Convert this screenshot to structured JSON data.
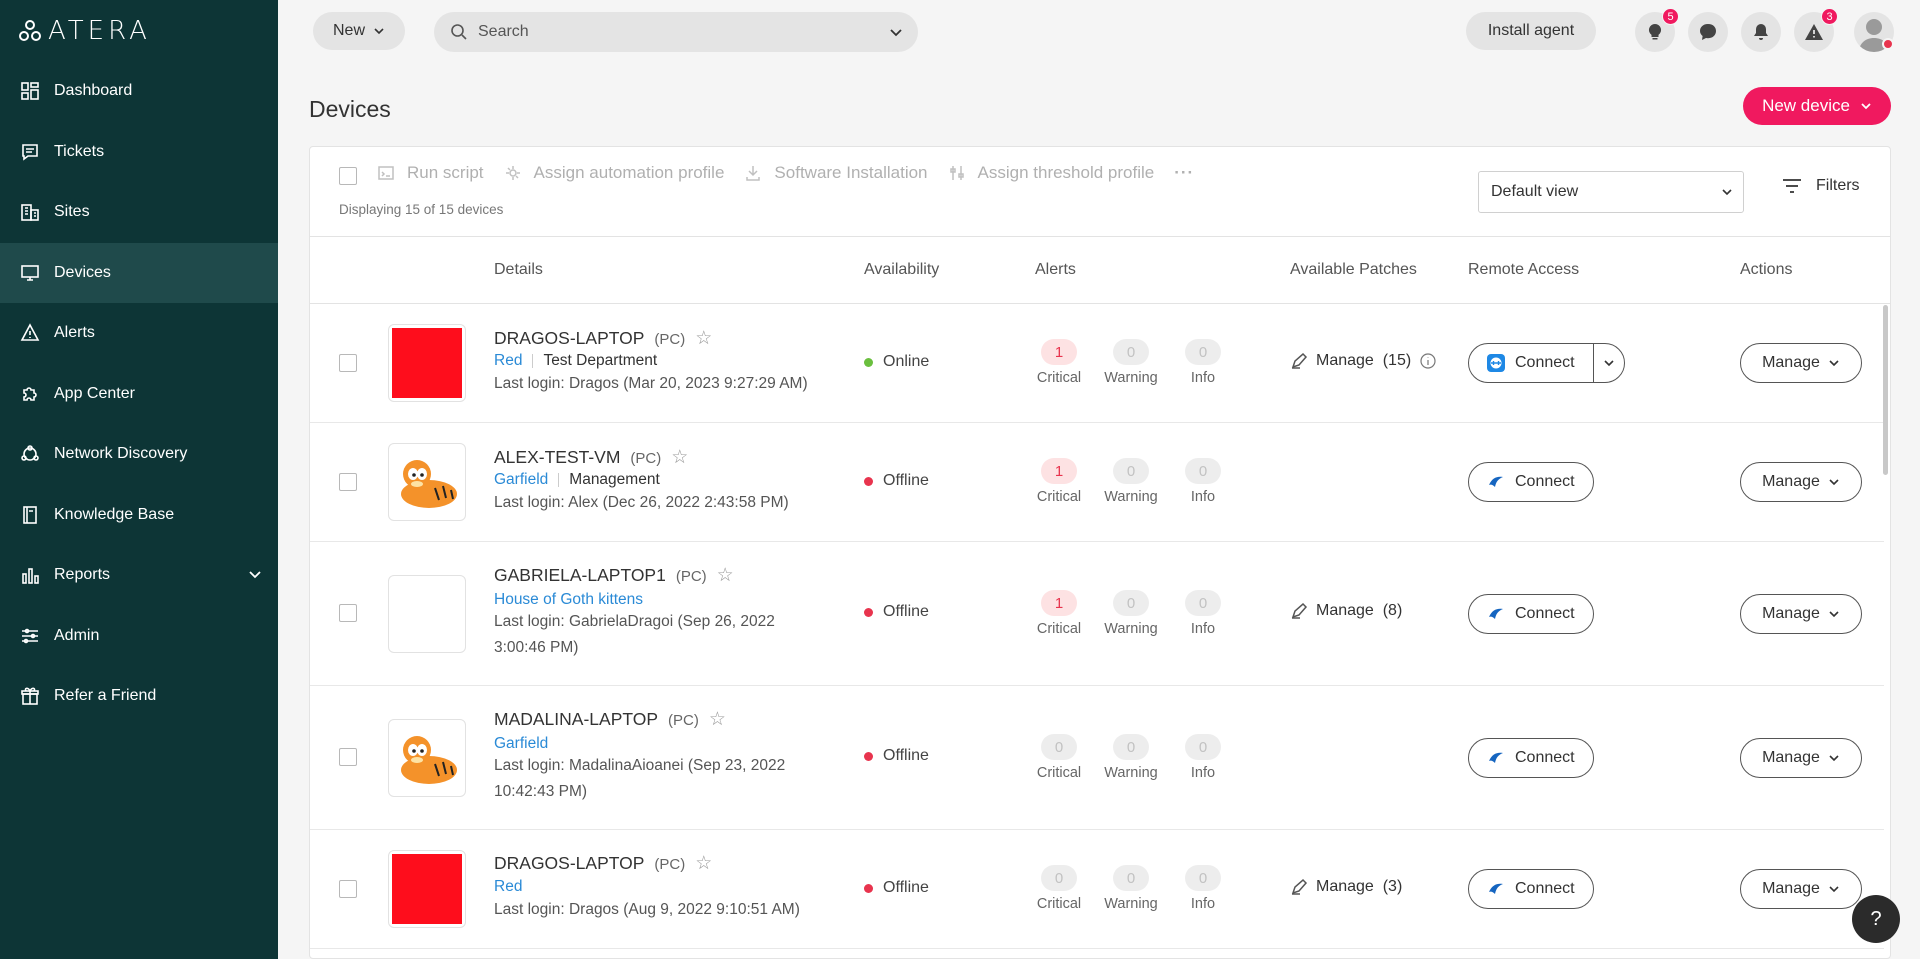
{
  "brand": {
    "name": "ATERA"
  },
  "sidebar": {
    "items": [
      {
        "label": "Dashboard",
        "icon": "dashboard-icon"
      },
      {
        "label": "Tickets",
        "icon": "ticket-icon"
      },
      {
        "label": "Sites",
        "icon": "building-icon"
      },
      {
        "label": "Devices",
        "icon": "monitor-icon",
        "active": true
      },
      {
        "label": "Alerts",
        "icon": "warning-icon"
      },
      {
        "label": "App Center",
        "icon": "puzzle-icon"
      },
      {
        "label": "Network Discovery",
        "icon": "network-icon"
      },
      {
        "label": "Knowledge Base",
        "icon": "book-icon"
      },
      {
        "label": "Reports",
        "icon": "chart-icon"
      },
      {
        "label": "Admin",
        "icon": "sliders-icon"
      },
      {
        "label": "Refer a Friend",
        "icon": "gift-icon"
      }
    ]
  },
  "topbar": {
    "new_label": "New",
    "search_placeholder": "Search",
    "install_agent_label": "Install agent",
    "notifications": {
      "tips_count": "5",
      "alerts_count": "3"
    }
  },
  "page": {
    "title": "Devices",
    "new_device_label": "New device"
  },
  "toolbar": {
    "run_script": "Run script",
    "assign_automation": "Assign automation profile",
    "software_installation": "Software Installation",
    "assign_threshold": "Assign threshold profile",
    "more": "···",
    "displaying": "Displaying 15 of 15 devices",
    "view": "Default view",
    "filters": "Filters"
  },
  "columns": {
    "details": "Details",
    "availability": "Availability",
    "alerts": "Alerts",
    "patches": "Available Patches",
    "remote": "Remote Access",
    "actions": "Actions"
  },
  "alert_labels": {
    "critical": "Critical",
    "warning": "Warning",
    "info": "Info"
  },
  "devices": [
    {
      "name": "DRAGOS-LAPTOP",
      "type": "(PC)",
      "site": "Red",
      "customer": "Test Department",
      "login_1": "Last login: Dragos (Mar 20, 2023 9:27:29 AM)",
      "login_2": "",
      "status": "Online",
      "status_color": "#6abf3e",
      "critical": "1",
      "warning": "0",
      "info": "0",
      "patches": "Manage  (15)",
      "connect": "Connect",
      "manage": "Manage",
      "thumb": "red"
    },
    {
      "name": "ALEX-TEST-VM",
      "type": "(PC)",
      "site": "Garfield",
      "customer": "Management",
      "login_1": "Last login: Alex (Dec 26, 2022 2:43:58 PM)",
      "login_2": "",
      "status": "Offline",
      "status_color": "#e8344e",
      "critical": "1",
      "warning": "0",
      "info": "0",
      "patches": "",
      "connect": "Connect",
      "manage": "Manage",
      "thumb": "garfield"
    },
    {
      "name": "GABRIELA-LAPTOP1",
      "type": "(PC)",
      "site": "House of Goth kittens",
      "customer": "",
      "login_1": "Last login: GabrielaDragoi (Sep 26, 2022",
      "login_2": "3:00:46 PM)",
      "status": "Offline",
      "status_color": "#e8344e",
      "critical": "1",
      "warning": "0",
      "info": "0",
      "patches": "Manage  (8)",
      "connect": "Connect",
      "manage": "Manage",
      "thumb": "blank"
    },
    {
      "name": "MADALINA-LAPTOP",
      "type": "(PC)",
      "site": "Garfield",
      "customer": "",
      "login_1": "Last login: MadalinaAioanei (Sep 23, 2022",
      "login_2": "10:42:43 PM)",
      "status": "Offline",
      "status_color": "#e8344e",
      "critical": "0",
      "warning": "0",
      "info": "0",
      "patches": "",
      "connect": "Connect",
      "manage": "Manage",
      "thumb": "garfield"
    },
    {
      "name": "DRAGOS-LAPTOP",
      "type": "(PC)",
      "site": "Red",
      "customer": "",
      "login_1": "Last login: Dragos (Aug 9, 2022 9:10:51 AM)",
      "login_2": "",
      "status": "Offline",
      "status_color": "#e8344e",
      "critical": "0",
      "warning": "0",
      "info": "0",
      "patches": "Manage  (3)",
      "connect": "Connect",
      "manage": "Manage",
      "thumb": "red"
    }
  ],
  "help_label": "?"
}
